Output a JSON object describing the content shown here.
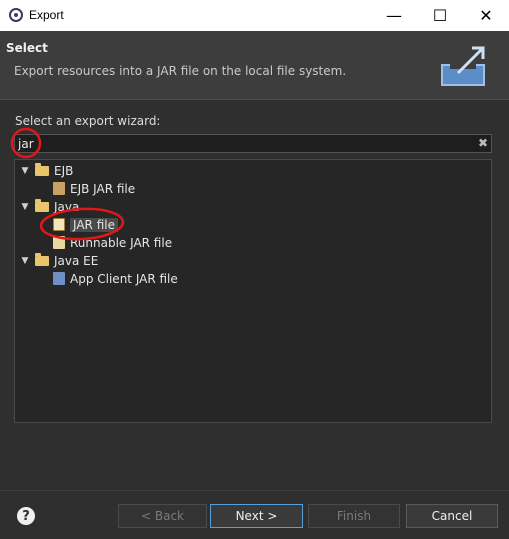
{
  "window": {
    "title": "Export"
  },
  "header": {
    "title": "Select",
    "description": "Export resources into a JAR file on the local file system."
  },
  "wizard": {
    "label": "Select an export wizard:",
    "filter_value": "jar",
    "clear_glyph": "✖"
  },
  "tree": {
    "groups": [
      {
        "label": "EJB",
        "items": [
          "EJB JAR file"
        ]
      },
      {
        "label": "Java",
        "items": [
          "JAR file",
          "Runnable JAR file"
        ]
      },
      {
        "label": "Java EE",
        "items": [
          "App Client JAR file"
        ]
      }
    ]
  },
  "buttons": {
    "back": "< Back",
    "next": "Next >",
    "finish": "Finish",
    "cancel": "Cancel",
    "help": "?"
  }
}
